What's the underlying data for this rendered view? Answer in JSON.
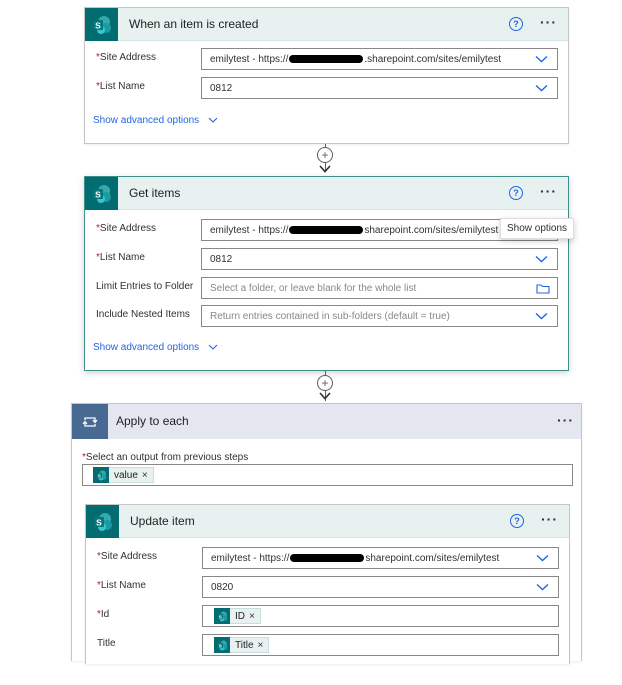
{
  "colors": {
    "sharepoint_teal": "#036c70",
    "header_bg": "#e6f1f0",
    "loop_blue": "#486991",
    "link_blue": "#2266e3",
    "required_red": "#a4262c"
  },
  "trigger": {
    "title": "When an item is created",
    "icon": "sharepoint-icon",
    "fields": {
      "site_address": {
        "label": "Site Address",
        "value_prefix": "emilytest - https://",
        "value_suffix": ".sharepoint.com/sites/emilytest"
      },
      "list_name": {
        "label": "List Name",
        "value": "0812"
      }
    },
    "advanced_label": "Show advanced options"
  },
  "get_items": {
    "title": "Get items",
    "icon": "sharepoint-icon",
    "fields": {
      "site_address": {
        "label": "Site Address",
        "value_prefix": "emilytest - https://",
        "value_suffix": "sharepoint.com/sites/emilytest"
      },
      "list_name": {
        "label": "List Name",
        "value": "0812"
      },
      "limit_folder": {
        "label": "Limit Entries to Folder",
        "placeholder": "Select a folder, or leave blank for the whole list"
      },
      "nested": {
        "label": "Include Nested Items",
        "placeholder": "Return entries contained in sub-folders (default = true)"
      }
    },
    "tooltip": "Show options",
    "advanced_label": "Show advanced options"
  },
  "apply_each": {
    "title": "Apply to each",
    "icon": "loop-icon",
    "select_label": "Select an output from previous steps",
    "token": "value"
  },
  "update_item": {
    "title": "Update item",
    "icon": "sharepoint-icon",
    "fields": {
      "site_address": {
        "label": "Site Address",
        "value_prefix": "emilytest - https://",
        "value_suffix": "sharepoint.com/sites/emilytest"
      },
      "list_name": {
        "label": "List Name",
        "value": "0820"
      },
      "id": {
        "label": "Id",
        "token": "ID"
      },
      "title": {
        "label": "Title",
        "token": "Title"
      }
    }
  },
  "glyphs": {
    "required": "*",
    "help": "?",
    "more": "···",
    "plus": "+",
    "remove": "×"
  }
}
